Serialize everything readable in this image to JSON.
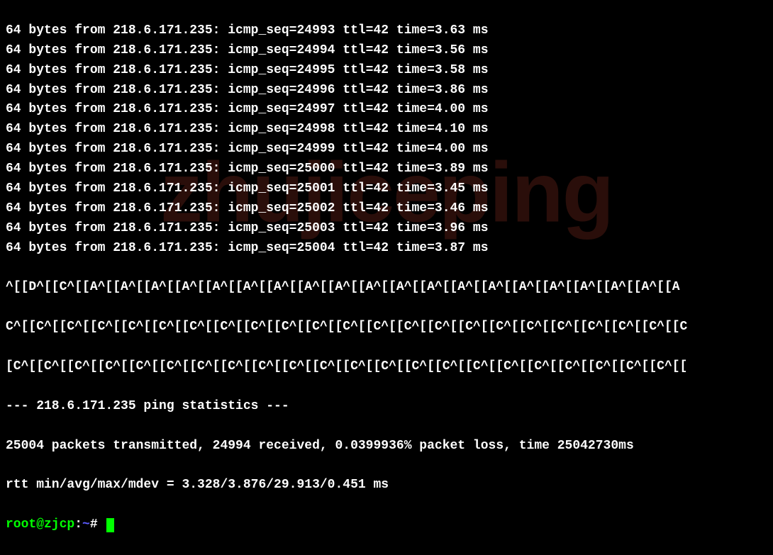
{
  "ping": {
    "host": "218.6.171.235",
    "bytes": 64,
    "ttl": 42,
    "lines": [
      {
        "seq": 24993,
        "time": "3.63"
      },
      {
        "seq": 24994,
        "time": "3.56"
      },
      {
        "seq": 24995,
        "time": "3.58"
      },
      {
        "seq": 24996,
        "time": "3.86"
      },
      {
        "seq": 24997,
        "time": "4.00"
      },
      {
        "seq": 24998,
        "time": "4.10"
      },
      {
        "seq": 24999,
        "time": "4.00"
      },
      {
        "seq": 25000,
        "time": "3.89"
      },
      {
        "seq": 25001,
        "time": "3.45"
      },
      {
        "seq": 25002,
        "time": "3.46"
      },
      {
        "seq": 25003,
        "time": "3.96"
      },
      {
        "seq": 25004,
        "time": "3.87"
      }
    ]
  },
  "escape_sequences": {
    "line1": "^[[D^[[C^[[A^[[A^[[A^[[A^[[A^[[A^[[A^[[A^[[A^[[A^[[A^[[A^[[A^[[A^[[A^[[A^[[A^[[A^[[A^[[A",
    "line2": "C^[[C^[[C^[[C^[[C^[[C^[[C^[[C^[[C^[[C^[[C^[[C^[[C^[[C^[[C^[[C^[[C^[[C^[[C^[[C^[[C^[[C^[[C",
    "line3": "[C^[[C^[[C^[[C^[[C^[[C^[[C^[[C^[[C^[[C^[[C^[[C^[[C^[[C^[[C^[[C^[[C^[[C^[[C^[[C^[[C^[[C^[["
  },
  "stats": {
    "header": "--- 218.6.171.235 ping statistics ---",
    "summary": "25004 packets transmitted, 24994 received, 0.0399936% packet loss, time 25042730ms",
    "rtt": "rtt min/avg/max/mdev = 3.328/3.876/29.913/0.451 ms"
  },
  "prompt": {
    "user": "root@zjcp",
    "colon": ":",
    "path": "~",
    "hash": "# "
  },
  "watermark": "zhujiceping"
}
